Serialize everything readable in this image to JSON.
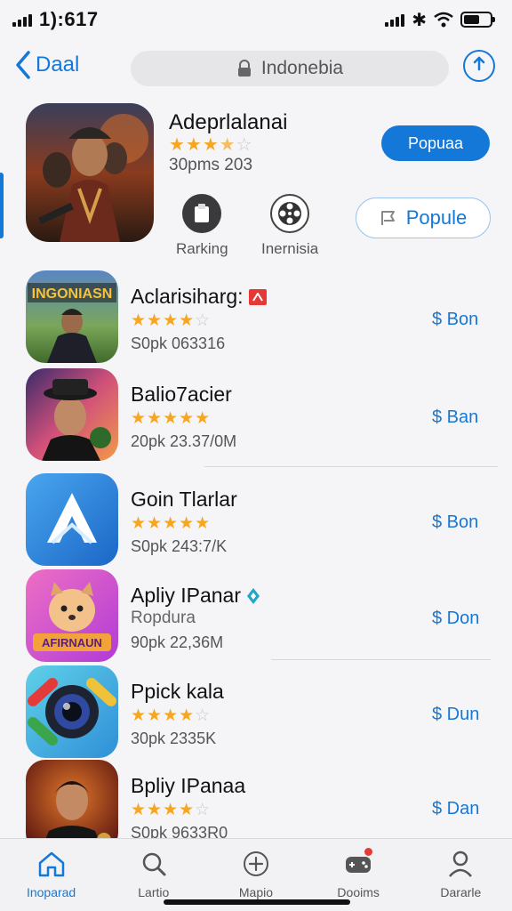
{
  "status": {
    "time": "1):617",
    "bluetooth": "✱"
  },
  "nav": {
    "back_label": "Daal",
    "search_text": "Indonebia"
  },
  "featured": {
    "title": "Adeprlalanai",
    "rating": 3.5,
    "meta": "30pms 203",
    "primary_button": "Popuaa",
    "secondary_button": "Popule",
    "actions": [
      {
        "label": "Rarking",
        "icon": "clipboard-icon"
      },
      {
        "label": "Inernisia",
        "icon": "film-reel-icon"
      }
    ]
  },
  "apps": [
    {
      "name": "Aclarisiharg:",
      "rating": 4,
      "meta": "S0pk 063316",
      "price": "$ Bon",
      "badge": "red-flag-icon",
      "icon_text": "INGONIASN",
      "icon_style": "game-hero"
    },
    {
      "name": "Balio7acier",
      "rating": 5,
      "meta": "20pk 23.37/0M",
      "price": "$ Ban",
      "icon_style": "portrait-hat"
    },
    {
      "name": "Goin Tlarlar",
      "rating": 5,
      "meta": "S0pk 243:7/K",
      "price": "$ Bon",
      "icon_style": "blue-a"
    },
    {
      "name": "Apliy IPanar",
      "subtitle": "Ropdura",
      "meta": "90pk 22,36M",
      "price": "$ Don",
      "badge": "blue-diamond-icon",
      "icon_text": "AFIRNAUN",
      "icon_style": "pink-dog"
    },
    {
      "name": "Ppick kala",
      "rating": 4,
      "meta": "30pk 2335K",
      "price": "$ Dun",
      "icon_style": "camera"
    },
    {
      "name": "Bpliy IPanaa",
      "rating": 4,
      "meta": "S0pk 9633R0",
      "price": "$ Dan",
      "icon_style": "portrait-red"
    }
  ],
  "tabs": [
    {
      "label": "Inoparad",
      "icon": "home-icon",
      "active": true
    },
    {
      "label": "Lartio",
      "icon": "search-icon",
      "active": false
    },
    {
      "label": "Mapio",
      "icon": "plus-circle-icon",
      "active": false
    },
    {
      "label": "Dooims",
      "icon": "game-controller-icon",
      "active": false,
      "badge": true
    },
    {
      "label": "Dararle",
      "icon": "person-icon",
      "active": false
    }
  ],
  "colors": {
    "accent": "#1478d8",
    "star": "#f5a623",
    "badge_red": "#e53935"
  }
}
